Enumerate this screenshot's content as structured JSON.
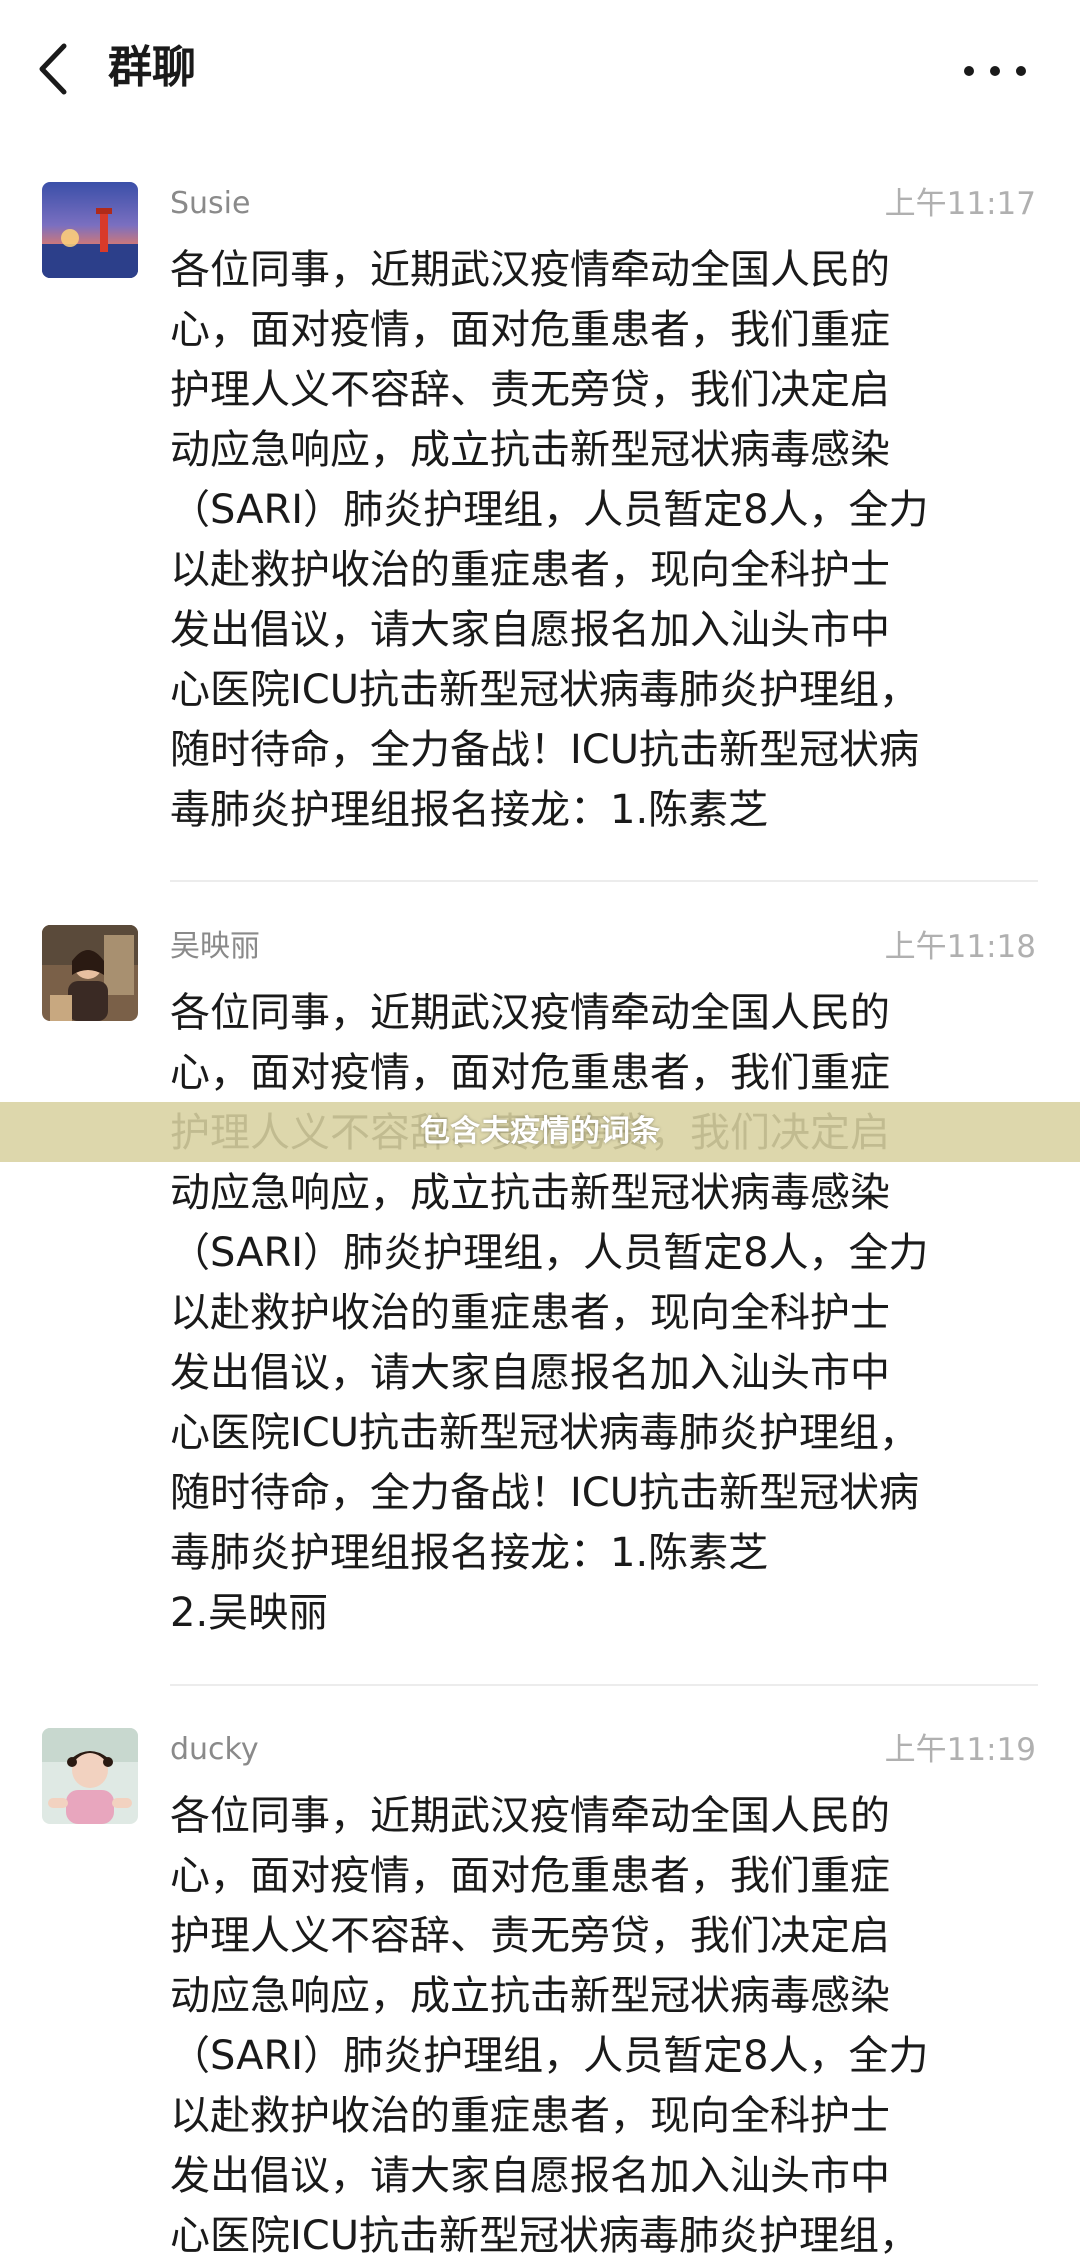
{
  "header": {
    "back_icon": "chevron-left-icon",
    "title": "群聊",
    "more_icon": "more-dots-icon"
  },
  "messages": [
    {
      "sender": "Susie",
      "time": "上午11:17",
      "avatar": "sunset-lighthouse-photo",
      "text": "各位同事，近期武汉疫情牵动全国人民的\n心，面对疫情，面对危重患者，我们重症\n护理人义不容辞、责无旁贷，我们决定启\n动应急响应，成立抗击新型冠状病毒感染\n（SARI）肺炎护理组，人员暂定8人，全力\n以赴救护收治的重症患者，现向全科护士\n发出倡议，请大家自愿报名加入汕头市中\n心医院ICU抗击新型冠状病毒肺炎护理组，\n随时待命，全力备战！ICU抗击新型冠状病\n毒肺炎护理组报名接龙：1.陈素芝"
    },
    {
      "sender": "吴映丽",
      "time": "上午11:18",
      "avatar": "woman-portrait-photo",
      "text": "各位同事，近期武汉疫情牵动全国人民的\n心，面对疫情，面对危重患者，我们重症\n护理人义不容辞、责无旁贷，我们决定启\n动应急响应，成立抗击新型冠状病毒感染\n（SARI）肺炎护理组，人员暂定8人，全力\n以赴救护收治的重症患者，现向全科护士\n发出倡议，请大家自愿报名加入汕头市中\n心医院ICU抗击新型冠状病毒肺炎护理组，\n随时待命，全力备战！ICU抗击新型冠状病\n毒肺炎护理组报名接龙：1.陈素芝\n2.吴映丽"
    },
    {
      "sender": "ducky",
      "time": "上午11:19",
      "avatar": "child-portrait-photo",
      "text": "各位同事，近期武汉疫情牵动全国人民的\n心，面对疫情，面对危重患者，我们重症\n护理人义不容辞、责无旁贷，我们决定启\n动应急响应，成立抗击新型冠状病毒感染\n（SARI）肺炎护理组，人员暂定8人，全力\n以赴救护收治的重症患者，现向全科护士\n发出倡议，请大家自愿报名加入汕头市中\n心医院ICU抗击新型冠状病毒肺炎护理组，"
    }
  ],
  "overlay": {
    "caption": "包含夫疫情的词条"
  },
  "colors": {
    "background": "#ffffff",
    "text": "#1a1a1a",
    "sender": "#8a8a8a",
    "time": "#b0b0b0",
    "divider": "#ececec",
    "caption_band": "#d8d2a0"
  }
}
